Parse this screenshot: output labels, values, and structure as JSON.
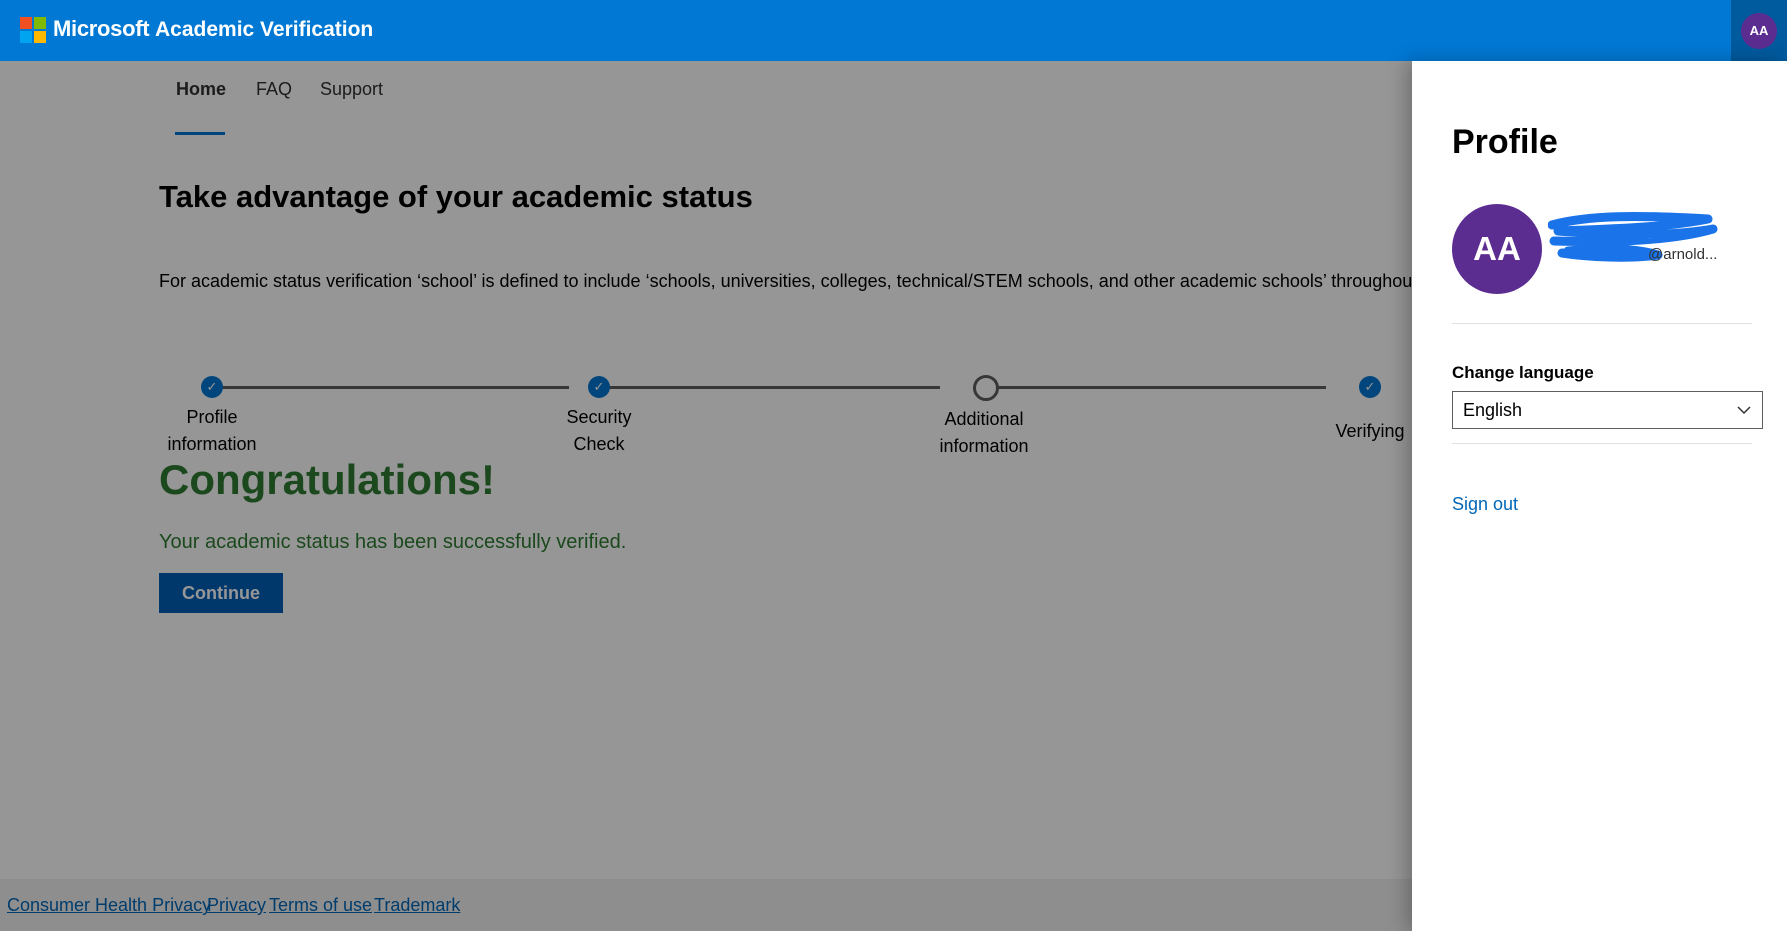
{
  "header": {
    "brand": "Microsoft",
    "app_title": "Academic Verification",
    "user_initials": "AA",
    "brand_color": "#0078d4"
  },
  "nav": {
    "items": [
      {
        "label": "Home",
        "active": true
      },
      {
        "label": "FAQ",
        "active": false
      },
      {
        "label": "Support",
        "active": false
      }
    ]
  },
  "main": {
    "title": "Take advantage of your academic status",
    "description": "For academic status verification ‘school’ is defined to include ‘schools, universities, colleges, technical/STEM schools, and other academic schools’ throughout the v",
    "steps": [
      {
        "line1": "Profile",
        "line2": "information",
        "state": "complete"
      },
      {
        "line1": "Security",
        "line2": "Check",
        "state": "complete"
      },
      {
        "line1": "Additional",
        "line2": "information",
        "state": "incomplete"
      },
      {
        "line1": "Verifying",
        "line2": "",
        "state": "complete"
      }
    ],
    "congrats": "Congratulations!",
    "success_message": "Your academic status has been successfully verified.",
    "continue_label": "Continue"
  },
  "footer": {
    "links": [
      "Consumer Health Privacy",
      "Privacy",
      "Terms of use",
      "Trademark"
    ]
  },
  "profile_panel": {
    "title": "Profile",
    "initials": "AA",
    "email_visible": "@arnold...",
    "change_language_label": "Change language",
    "language_value": "English",
    "sign_out_label": "Sign out"
  }
}
